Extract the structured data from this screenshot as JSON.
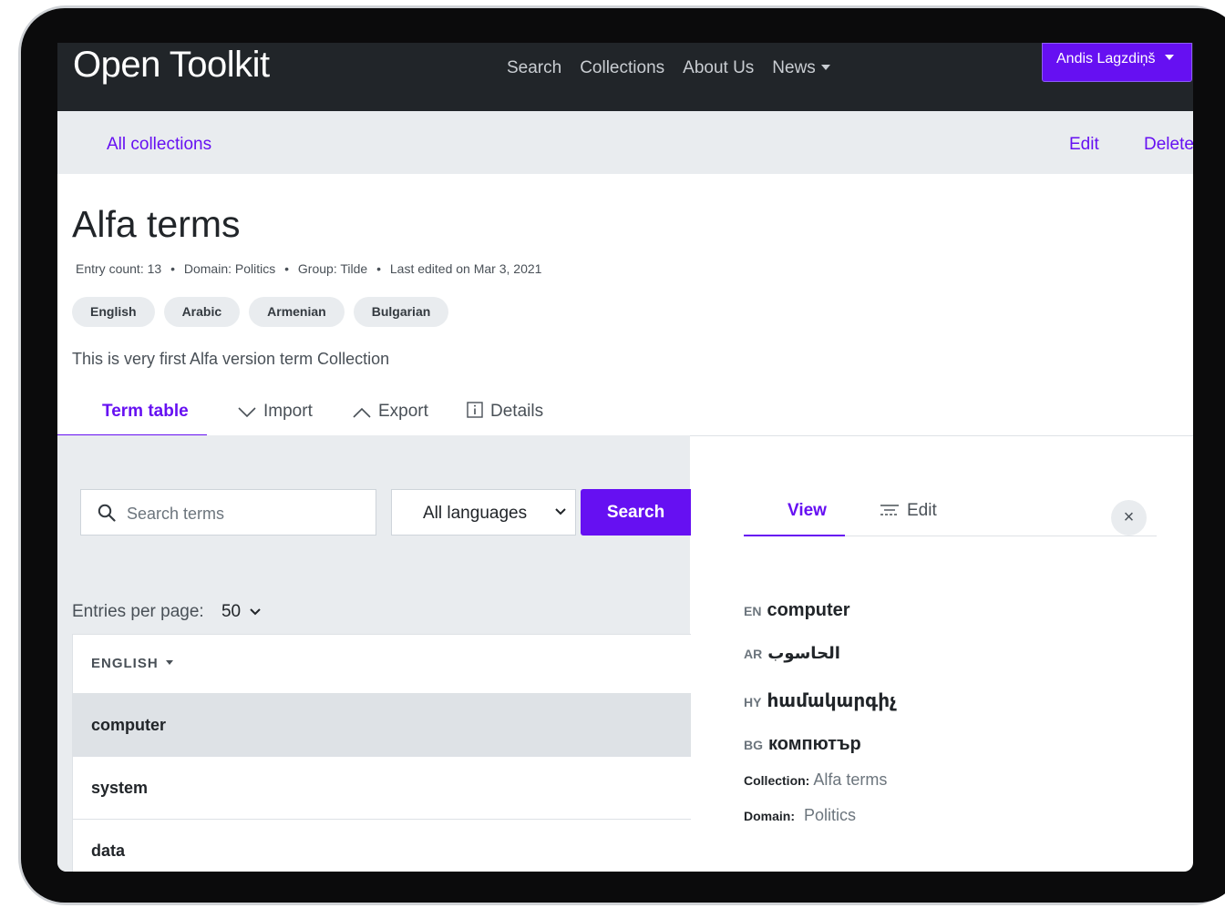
{
  "navbar": {
    "brand": "Open Toolkit",
    "links": [
      "Search",
      "Collections",
      "About Us",
      "News"
    ],
    "user": "Andis Lagzdiņš"
  },
  "subbar": {
    "all_collections": "All collections",
    "edit": "Edit",
    "delete": "Delete"
  },
  "collection": {
    "title": "Alfa terms",
    "meta": {
      "entry_count": "Entry count: 13",
      "domain": "Domain: Politics",
      "group": "Group: Tilde",
      "last_edited": "Last edited on Mar 3, 2021",
      "separator": "•"
    },
    "languages": [
      "English",
      "Arabic",
      "Armenian",
      "Bulgarian"
    ],
    "description": "This is very first Alfa version term Collection"
  },
  "tabs": {
    "term_table": "Term table",
    "import": "Import",
    "export": "Export",
    "details": "Details"
  },
  "search": {
    "placeholder": "Search terms",
    "language_select": "All languages",
    "button": "Search"
  },
  "pagination": {
    "label": "Entries per page:",
    "value": "50"
  },
  "table": {
    "header": "ENGLISH",
    "rows": [
      "computer",
      "system",
      "data"
    ],
    "selected_row": "computer"
  },
  "detail": {
    "tabs": {
      "view": "View",
      "edit": "Edit"
    },
    "close": "×",
    "entries": [
      {
        "code": "EN",
        "term": "computer"
      },
      {
        "code": "AR",
        "term": "الحاسوب"
      },
      {
        "code": "HY",
        "term": "համակարգիչ"
      },
      {
        "code": "BG",
        "term": "компютър"
      }
    ],
    "collection_label": "Collection:",
    "collection_value": "Alfa terms",
    "domain_label": "Domain:",
    "domain_value": "Politics"
  },
  "colors": {
    "accent": "#6610f2",
    "navbar": "#212529",
    "subbar": "#e9ecef"
  }
}
